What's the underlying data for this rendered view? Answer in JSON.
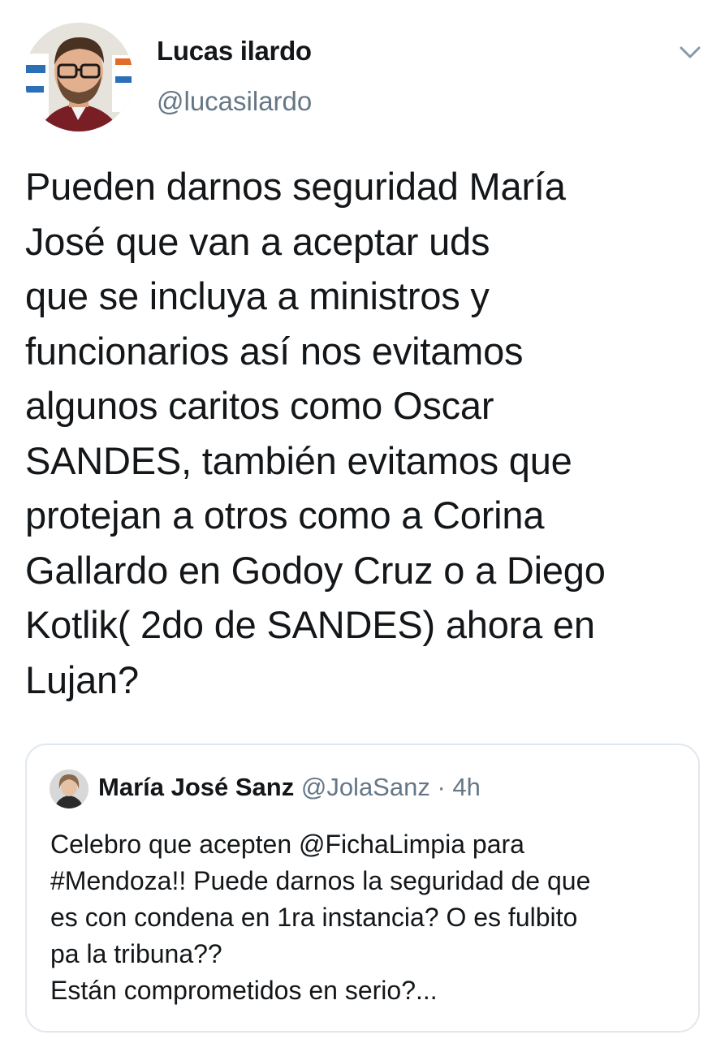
{
  "tweet": {
    "author": {
      "name": "Lucas ilardo",
      "handle": "@lucasilardo",
      "avatar_icon": "profile-photo"
    },
    "menu_icon": "chevron-down-icon",
    "text": "Pueden darnos seguridad María\nJosé que van a aceptar uds\nque se incluya a ministros y\nfuncionarios así nos evitamos\nalgunos caritos como Oscar\nSANDES, también  evitamos que\nprotejan a otros como a Corina\nGallardo en Godoy Cruz o a Diego\nKotlik( 2do de SANDES) ahora en\nLujan?"
  },
  "quoted_tweet": {
    "author": {
      "name": "María José Sanz",
      "handle": "@JolaSanz",
      "avatar_icon": "profile-photo"
    },
    "separator": "·",
    "time": "4h",
    "text": "Celebro que acepten @FichaLimpia para\n#Mendoza!! Puede darnos la seguridad de que\nes con condena en 1ra instancia? O es fulbito\npa la tribuna??\nEstán comprometidos en serio?..."
  },
  "colors": {
    "text_primary": "#14171a",
    "text_secondary": "#657786",
    "border": "#e1e8ed",
    "background": "#ffffff"
  }
}
